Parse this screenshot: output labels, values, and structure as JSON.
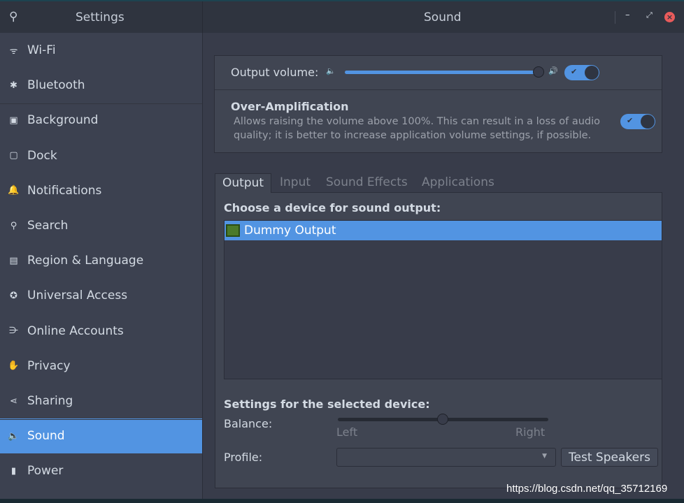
{
  "header": {
    "left_title": "Settings",
    "right_title": "Sound",
    "search_icon": "search-icon",
    "window_controls": [
      "minimize",
      "maximize",
      "close"
    ],
    "close_color": "#e95b5b"
  },
  "sidebar": {
    "items": [
      {
        "label": "Wi-Fi",
        "icon": "wifi-icon",
        "glyph": "ᯤ"
      },
      {
        "label": "Bluetooth",
        "icon": "bluetooth-icon",
        "glyph": "✱"
      },
      {
        "label": "Background",
        "icon": "background-icon",
        "glyph": "▣"
      },
      {
        "label": "Dock",
        "icon": "dock-icon",
        "glyph": "▢"
      },
      {
        "label": "Notifications",
        "icon": "bell-icon",
        "glyph": "🔔"
      },
      {
        "label": "Search",
        "icon": "search-icon",
        "glyph": "⚲"
      },
      {
        "label": "Region & Language",
        "icon": "region-icon",
        "glyph": "▤"
      },
      {
        "label": "Universal Access",
        "icon": "accessibility-icon",
        "glyph": "✪"
      },
      {
        "label": "Online Accounts",
        "icon": "online-accounts-icon",
        "glyph": "⋺"
      },
      {
        "label": "Privacy",
        "icon": "hand-icon",
        "glyph": "✋"
      },
      {
        "label": "Sharing",
        "icon": "share-icon",
        "glyph": "⋖"
      },
      {
        "label": "Sound",
        "icon": "speaker-icon",
        "glyph": "🔈",
        "selected": true
      },
      {
        "label": "Power",
        "icon": "power-icon",
        "glyph": "▮"
      }
    ]
  },
  "volume": {
    "label": "Output volume:",
    "level_percent": 100,
    "enabled": true
  },
  "over": {
    "title": "Over-Amplification",
    "desc1": "Allows raising the volume above 100%. This can result in a loss of audio",
    "desc2": "quality; it is better to increase application volume settings, if possible.",
    "enabled": true
  },
  "tabs": [
    "Output",
    "Input",
    "Sound Effects",
    "Applications"
  ],
  "output": {
    "heading": "Choose a device for sound output:",
    "devices": [
      "Dummy Output"
    ],
    "settings_heading": "Settings for the selected device:",
    "balance_label": "Balance:",
    "balance_value": 0.5,
    "left": "Left",
    "right": "Right",
    "profile_label": "Profile:",
    "profile_value": "",
    "test_button": "Test Speakers"
  },
  "watermark": "https://blog.csdn.net/qq_35712169",
  "accent": "#5294e2"
}
